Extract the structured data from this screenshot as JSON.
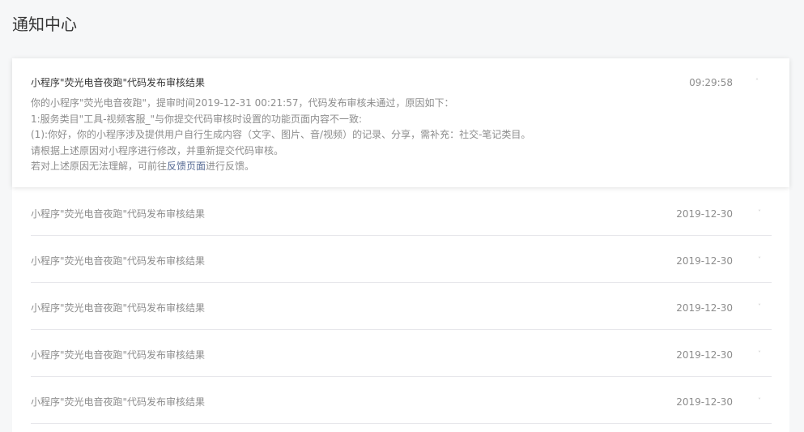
{
  "page": {
    "title": "通知中心"
  },
  "expanded_message": {
    "title": "小程序\"荧光电音夜跑\"代码发布审核结果",
    "time": "09:29:58",
    "body_lines": [
      "你的小程序\"荧光电音夜跑\"，提审时间2019-12-31 00:21:57，代码发布审核未通过，原因如下：",
      "1:服务类目\"工具-视频客服_\"与你提交代码审核时设置的功能页面内容不一致:",
      "(1):你好，你的小程序涉及提供用户自行生成内容（文字、图片、音/视频）的记录、分享，需补充：社交-笔记类目。",
      "请根据上述原因对小程序进行修改，并重新提交代码审核。"
    ],
    "last_line_prefix": "若对上述原因无法理解，可前往",
    "feedback_link": "反馈页面",
    "last_line_suffix": "进行反馈。",
    "toggle_icon": "˄"
  },
  "messages": [
    {
      "title": "小程序\"荧光电音夜跑\"代码发布审核结果",
      "date": "2019-12-30",
      "toggle_icon": "˅"
    },
    {
      "title": "小程序\"荧光电音夜跑\"代码发布审核结果",
      "date": "2019-12-30",
      "toggle_icon": "˅"
    },
    {
      "title": "小程序\"荧光电音夜跑\"代码发布审核结果",
      "date": "2019-12-30",
      "toggle_icon": "˅"
    },
    {
      "title": "小程序\"荧光电音夜跑\"代码发布审核结果",
      "date": "2019-12-30",
      "toggle_icon": "˅"
    },
    {
      "title": "小程序\"荧光电音夜跑\"代码发布审核结果",
      "date": "2019-12-30",
      "toggle_icon": "˅"
    }
  ],
  "colors": {
    "background": "#f6f7f8",
    "link": "#576b95",
    "title_text": "#353535",
    "muted_text": "#8d8d8d",
    "divider": "#e7e7eb"
  }
}
